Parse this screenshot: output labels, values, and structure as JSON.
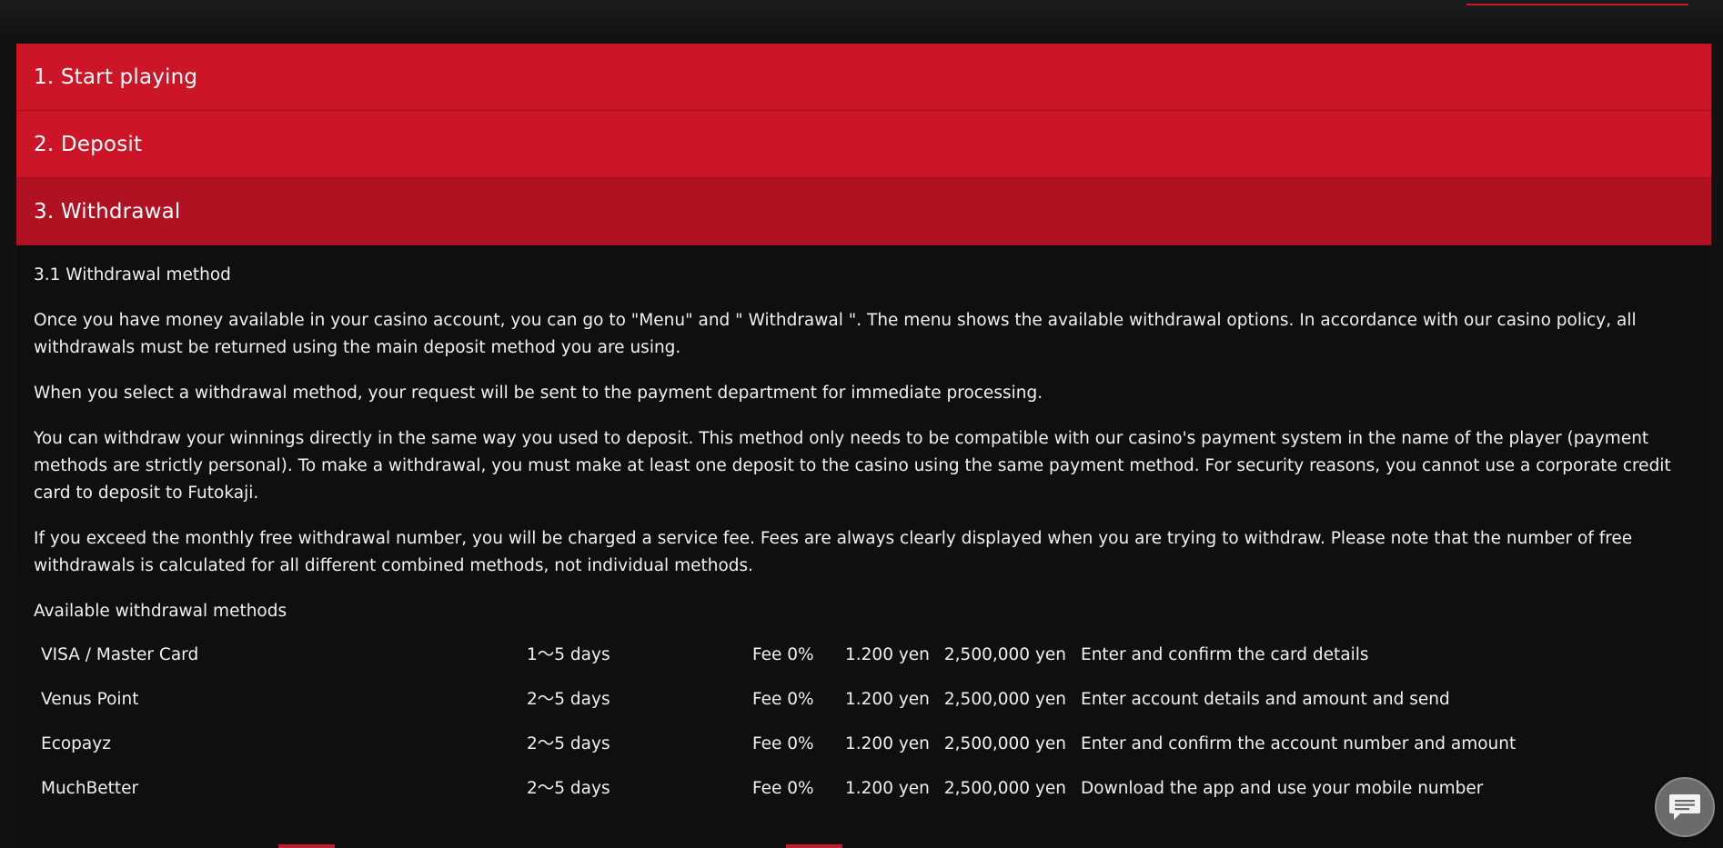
{
  "accordion": {
    "items": [
      {
        "label": "1. Start playing"
      },
      {
        "label": "2. Deposit"
      },
      {
        "label": "3. Withdrawal"
      }
    ]
  },
  "withdrawal": {
    "subheading": "3.1 Withdrawal method",
    "paragraphs": [
      "Once you have money available in your casino account, you can go to \"Menu\" and \" Withdrawal \". The menu shows the available withdrawal options. In accordance with our casino policy, all withdrawals must be returned using the main deposit method you are using.",
      "When you select a withdrawal method, your request will be sent to the payment department for immediate processing.",
      "You can withdraw your winnings directly in the same way you used to deposit. This method only needs to be compatible with our casino's payment system in the name of the player (payment methods are strictly personal). To make a withdrawal, you must make at least one deposit to the casino using the same payment method. For security reasons, you cannot use a corporate credit card to deposit to Futokaji.",
      "If you exceed the monthly free withdrawal number, you will be charged a service fee. Fees are always clearly displayed when you are trying to withdraw. Please note that the number of free withdrawals is calculated for all different combined methods, not individual methods."
    ],
    "methods_heading": "Available withdrawal methods",
    "methods": [
      {
        "name": "VISA / Master Card",
        "time": "1〜5 days",
        "fee": "Fee 0%",
        "min": "1.200 yen",
        "max": "2,500,000 yen",
        "note": "Enter and confirm the card details"
      },
      {
        "name": "Venus Point",
        "time": "2〜5 days",
        "fee": "Fee 0%",
        "min": "1.200 yen",
        "max": "2,500,000 yen",
        "note": "Enter account details and amount and send"
      },
      {
        "name": "Ecopayz",
        "time": "2〜5 days",
        "fee": "Fee 0%",
        "min": "1.200 yen",
        "max": "2,500,000 yen",
        "note": "Enter and confirm the account number and amount"
      },
      {
        "name": "MuchBetter",
        "time": "2〜5 days",
        "fee": "Fee 0%",
        "min": "1.200 yen",
        "max": "2,500,000 yen",
        "note": "Download the app and use your mobile number"
      }
    ]
  },
  "chat": {
    "icon": "chat-bubble-icon"
  },
  "colors": {
    "accent": "#cc1527",
    "accent_active": "#b01222",
    "background": "#0f0f0f",
    "text": "#f0f0f0"
  }
}
